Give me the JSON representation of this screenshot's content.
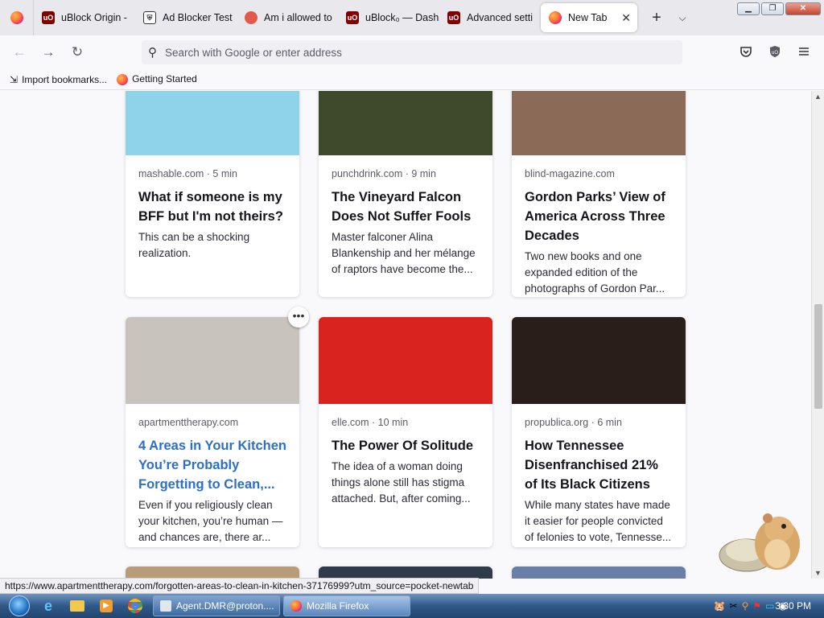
{
  "tabs": [
    {
      "label": "uBlock Origin -",
      "icon": "ublock-icon",
      "color": "#800000"
    },
    {
      "label": "Ad Blocker Test",
      "icon": "shield-icon",
      "color": "#333333"
    },
    {
      "label": "Am i allowed to",
      "icon": "ghost-icon",
      "color": "#e05a4c"
    },
    {
      "label": "uBlock₀ — Dash",
      "icon": "ublock-icon",
      "color": "#800000"
    },
    {
      "label": "Advanced setti",
      "icon": "ublock-icon",
      "color": "#800000"
    }
  ],
  "active_tab": {
    "label": "New Tab",
    "close": "✕"
  },
  "new_tab_button": "+",
  "list_tabs_button": "⌵",
  "window_controls": {
    "minimize": "▁",
    "restore": "❐",
    "close": "✕"
  },
  "nav": {
    "back": "←",
    "forward": "→",
    "reload": "↻"
  },
  "address_bar": {
    "placeholder": "Search with Google or enter address"
  },
  "bookmarks": [
    {
      "label": "Import bookmarks...",
      "icon": "import-icon"
    },
    {
      "label": "Getting Started",
      "icon": "firefox-icon"
    }
  ],
  "cards": [
    {
      "source": "mashable.com · 5 min",
      "title": "What if someone is my BFF but I'm not theirs?",
      "excerpt": "This can be a shocking realization.",
      "image_color": "#8fd3e8",
      "hover": false
    },
    {
      "source": "punchdrink.com · 9 min",
      "title": "The Vineyard Falcon Does Not Suffer Fools",
      "excerpt": "Master falconer Alina Blankenship and her mélange of raptors have become the...",
      "image_color": "#3f4a2a",
      "hover": false
    },
    {
      "source": "blind-magazine.com",
      "title": "Gordon Parks’ View of America Across Three Decades",
      "excerpt": "Two new books and one expanded edition of the photographs of Gordon Par...",
      "image_color": "#8b6a58",
      "hover": false
    },
    {
      "source": "apartmenttherapy.com",
      "title": "4 Areas in Your Kitchen You’re Probably Forgetting to Clean,...",
      "excerpt": "Even if you religiously clean your kitchen, you’re human — and chances are, there ar...",
      "image_color": "#c8c4bd",
      "hover": true
    },
    {
      "source": "elle.com · 10 min",
      "title": "The Power Of Solitude",
      "excerpt": "The idea of a woman doing things alone still has stigma attached. But, after coming...",
      "image_color": "#d9231f",
      "hover": false
    },
    {
      "source": "propublica.org · 6 min",
      "title": "How Tennessee Disenfranchised 21% of Its Black Citizens",
      "excerpt": "While many states have made it easier for people convicted of felonies to vote, Tennesse...",
      "image_color": "#2a1e1a",
      "hover": false
    }
  ],
  "card_menu_button": "•••",
  "status_url": "https://www.apartmenttherapy.com/forgotten-areas-to-clean-in-kitchen-37176999?utm_source=pocket-newtab",
  "taskbar": {
    "tasks": [
      {
        "label": "Agent.DMR@proton....",
        "active": false
      },
      {
        "label": "Mozilla Firefox",
        "active": true
      }
    ],
    "clock": "3:30 PM"
  }
}
